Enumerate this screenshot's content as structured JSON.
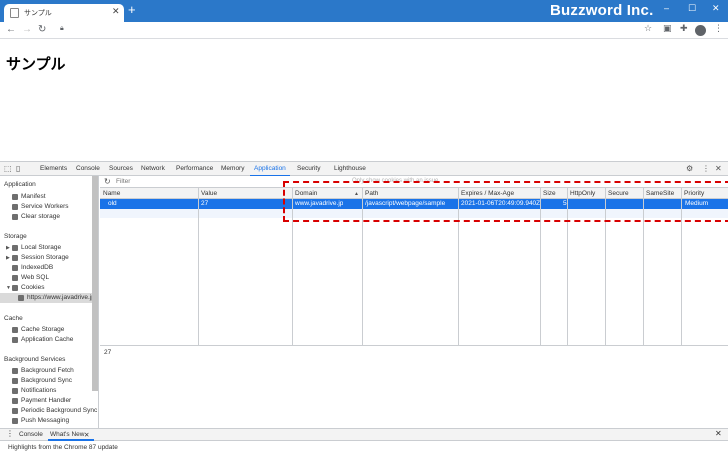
{
  "browser": {
    "tab_title": "サンプル",
    "new_tab": "+",
    "brand": "Buzzword Inc.",
    "window_buttons": [
      "–",
      "☐",
      "✕"
    ]
  },
  "page": {
    "heading": "サンプル"
  },
  "devtools": {
    "tabs": [
      "Elements",
      "Console",
      "Sources",
      "Network",
      "Performance",
      "Memory",
      "Application",
      "Security",
      "Lighthouse"
    ],
    "active_tab": "Application",
    "filter_placeholder": "Filter",
    "hint": "Only show cookies with an issue",
    "sidebar": {
      "application_header": "Application",
      "application_items": [
        "Manifest",
        "Service Workers",
        "Clear storage"
      ],
      "storage_header": "Storage",
      "storage_items": [
        "Local Storage",
        "Session Storage",
        "IndexedDB",
        "Web SQL",
        "Cookies"
      ],
      "cookie_origin": "https://www.javadrive.jp",
      "cache_header": "Cache",
      "cache_items": [
        "Cache Storage",
        "Application Cache"
      ],
      "bg_header": "Background Services",
      "bg_items": [
        "Background Fetch",
        "Background Sync",
        "Notifications",
        "Payment Handler",
        "Periodic Background Sync",
        "Push Messaging"
      ]
    },
    "table": {
      "columns": [
        "Name",
        "Value",
        "Domain",
        "Path",
        "Expires / Max-Age",
        "Size",
        "HttpOnly",
        "Secure",
        "SameSite",
        "Priority"
      ],
      "sort_indicator": "▲",
      "row": {
        "name": "old",
        "value": "27",
        "domain": "www.javadrive.jp",
        "path": "/javascript/webpage/sample",
        "expires": "2021-01-06T20:49:09.940Z",
        "size": "5",
        "httponly": "",
        "secure": "",
        "samesite": "",
        "priority": "Medium"
      }
    },
    "preview_value": "27",
    "drawer": {
      "tabs": [
        "Console",
        "What's New"
      ],
      "body": "Highlights from the Chrome 87 update"
    }
  },
  "colors": {
    "titlebar": "#2b78c9",
    "accent": "#1a73e8",
    "highlight": "#d80000"
  }
}
